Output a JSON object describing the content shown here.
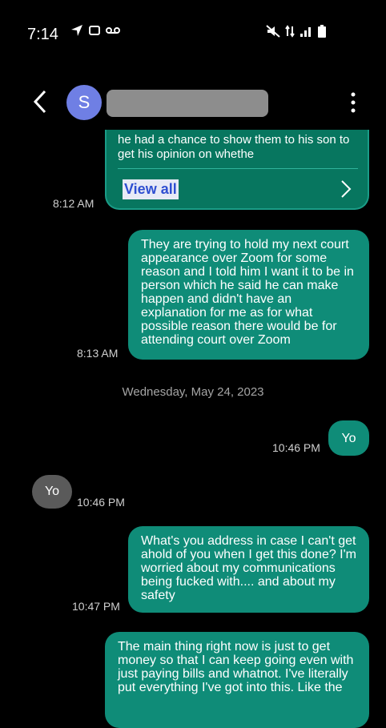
{
  "status_bar": {
    "time": "7:14",
    "left_icons": [
      "navigation-icon",
      "screenshot-icon",
      "voicemail-icon"
    ],
    "right_icons": [
      "mute-icon",
      "data-icon",
      "signal-icon",
      "battery-icon"
    ]
  },
  "header": {
    "avatar_letter": "S",
    "contact_name": ""
  },
  "messages": {
    "m0": {
      "text": "he had a chance to show them to his son to get his opinion on whethe",
      "action": "View all",
      "time": "8:12 AM",
      "direction": "outgoing"
    },
    "m1": {
      "text": "They are trying to hold my next court appearance over Zoom for some reason and I told him I want it to be in person which he said he can make happen and didn't have an explanation for me as for what possible reason there would be for attending court over Zoom",
      "time": "8:13 AM",
      "direction": "outgoing"
    },
    "date_separator": "Wednesday, May 24, 2023",
    "m2": {
      "text": "Yo",
      "time": "10:46 PM",
      "direction": "outgoing"
    },
    "m3": {
      "text": "Yo",
      "time": "10:46 PM",
      "direction": "incoming"
    },
    "m4": {
      "text": "What's you address in case I can't get ahold of you when I get this done? I'm worried about my communications being fucked with.... and about my safety",
      "time": "10:47 PM",
      "direction": "outgoing"
    },
    "m5": {
      "text": "The main thing right now is just to get money so that I can keep going even with just paying bills and whatnot.  I've literally put everything I've got into this.  Like the",
      "direction": "outgoing"
    }
  },
  "colors": {
    "outgoing_bubble": "#0f8c78",
    "incoming_bubble": "#5a5a5a",
    "avatar": "#6f7fe4",
    "background": "#000000"
  }
}
